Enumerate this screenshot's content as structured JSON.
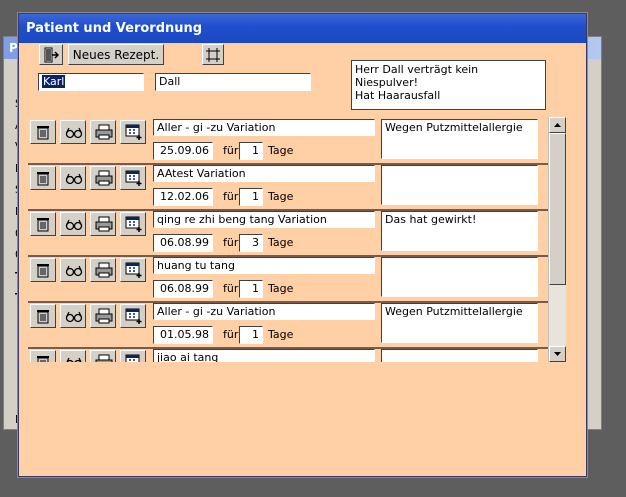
{
  "background_window": {
    "title_initial": "P",
    "side_chars": [
      "S",
      "A",
      "V",
      "N",
      "S",
      "R",
      "0",
      "0",
      "T",
      "T"
    ],
    "bottom_char": "D"
  },
  "window": {
    "title": "Patient und Verordnung"
  },
  "toolbar": {
    "new_prescription_label": "Neues Rezept."
  },
  "patient": {
    "first_name": "Karl",
    "last_name": "Dall",
    "note": "Herr Dall verträgt kein Niespulver!\nHat Haarausfall"
  },
  "labels": {
    "fur": "für",
    "tage": "Tage"
  },
  "prescriptions": [
    {
      "name": "Aller - gi -zu Variation",
      "date": "25.09.06",
      "days": "1",
      "note": "Wegen Putzmittelallergie"
    },
    {
      "name": "AAtest Variation",
      "date": "12.02.06",
      "days": "1",
      "note": ""
    },
    {
      "name": "qing re zhi beng tang Variation",
      "date": "06.08.99",
      "days": "3",
      "note": "Das hat gewirkt!"
    },
    {
      "name": "huang tu tang",
      "date": "06.08.99",
      "days": "1",
      "note": ""
    },
    {
      "name": "Aller - gi -zu Variation",
      "date": "01.05.98",
      "days": "1",
      "note": "Wegen Putzmittelallergie"
    },
    {
      "name": "jiao ai tang",
      "date": "",
      "days": "",
      "note": ""
    }
  ],
  "icons": {
    "exit": "exit-door-icon",
    "layout": "frame-icon",
    "delete": "trash-icon",
    "view": "glasses-icon",
    "print": "printer-icon",
    "calendar": "calendar-add-icon"
  }
}
